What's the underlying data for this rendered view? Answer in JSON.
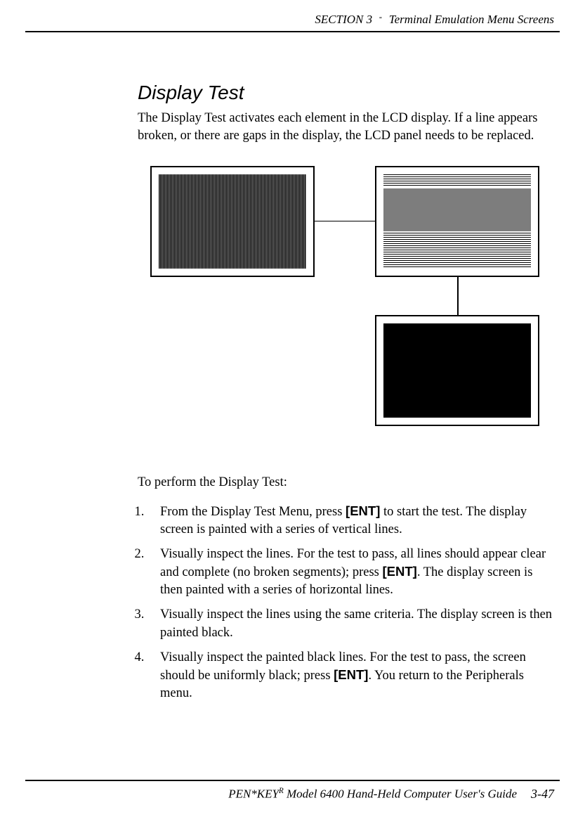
{
  "header": {
    "section": "SECTION 3",
    "separator": "\"",
    "title": "Terminal Emulation Menu Screens"
  },
  "content": {
    "heading": "Display Test",
    "intro": "The Display Test activates each element in the LCD display. If a line appears broken, or there are gaps in the display, the LCD panel needs to be replaced.",
    "subhead": "To perform the Display Test:",
    "steps": [
      {
        "pre": "From the Display Test Menu, press ",
        "key": "[ENT]",
        "post": " to start the test.  The display screen is painted with a series of vertical lines."
      },
      {
        "pre": "Visually inspect the lines.  For the test to pass, all lines should appear clear and complete (no broken segments); press ",
        "key": "[ENT]",
        "post": ".  The display screen is then painted with a series of horizontal lines."
      },
      {
        "pre": "Visually inspect the lines using the same criteria.  The display screen is then painted black.",
        "key": "",
        "post": ""
      },
      {
        "pre": "Visually inspect the painted black lines.  For the test to pass, the screen should be uniformly black; press ",
        "key": "[ENT]",
        "post": ".  You return to the Peripherals menu."
      }
    ]
  },
  "footer": {
    "product_prefix": "PEN*KEY",
    "product_sup": "R",
    "product_rest": " Model 6400 Hand-Held Computer User's Guide",
    "page": "3-47"
  }
}
